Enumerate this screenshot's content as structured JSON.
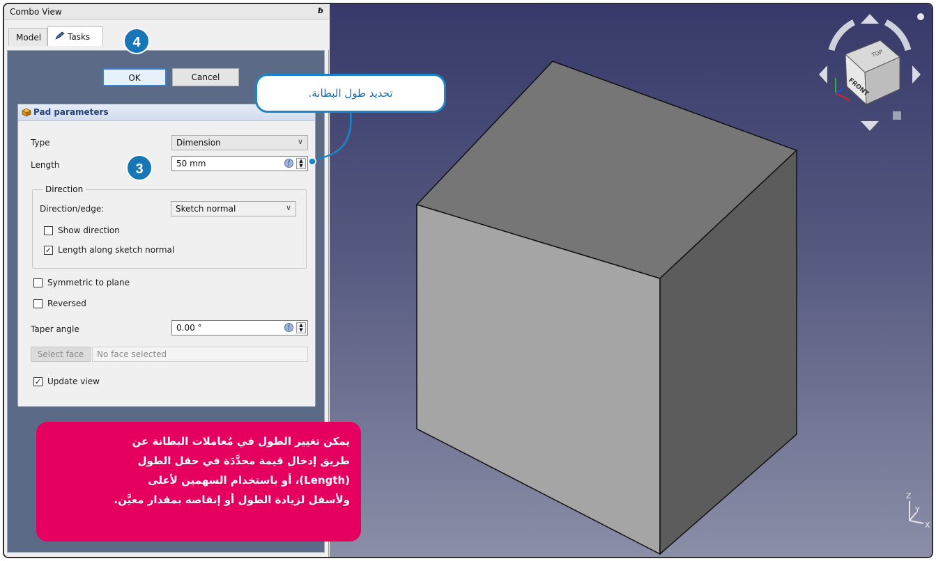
{
  "combo_view": {
    "title": "Combo View",
    "float_icon": "ƀ",
    "tabs": [
      {
        "label": "Model",
        "active": false
      },
      {
        "label": "Tasks",
        "active": true,
        "icon": "pencil-icon"
      }
    ]
  },
  "dialog": {
    "ok_label": "OK",
    "cancel_label": "Cancel"
  },
  "pad_parameters": {
    "title": "Pad parameters",
    "icon": "pad-icon",
    "type_label": "Type",
    "type_value": "Dimension",
    "length_label": "Length",
    "length_value": "50 mm",
    "direction": {
      "title": "Direction",
      "edge_label": "Direction/edge:",
      "edge_value": "Sketch normal",
      "show_direction_label": "Show direction",
      "show_direction_checked": false,
      "length_along_label": "Length along sketch normal",
      "length_along_checked": true
    },
    "symmetric_label": "Symmetric to plane",
    "symmetric_checked": false,
    "reversed_label": "Reversed",
    "reversed_checked": false,
    "taper_label": "Taper angle",
    "taper_value": "0.00 °",
    "select_face_label": "Select face",
    "face_field_value": "No face selected",
    "update_view_label": "Update view",
    "update_view_checked": true
  },
  "navigation_cube": {
    "front_label": "FRONT",
    "top_label": "TOP"
  },
  "axis_indicator": {
    "z": "Z",
    "y": "Y",
    "x": "X"
  },
  "callouts": {
    "step3": "3",
    "step4": "4",
    "bubble_text": "تحديد طول البطانة.",
    "note_lines": [
      "يمكن تغيير الطول في مُعاملات البطانة عن",
      "طريق إدخال قيمة محدَّدَة في حقل الطول",
      "(Length)، أو باستخدام السهمين لأعلى",
      "ولأسفل لزيادة الطول أو إنقاصه بمقدار معيَّن."
    ]
  },
  "colors": {
    "callout_blue": "#1776b6",
    "note_magenta": "#e5005f",
    "viewport_top": "#37396a",
    "viewport_bottom": "#8b8ea7"
  }
}
